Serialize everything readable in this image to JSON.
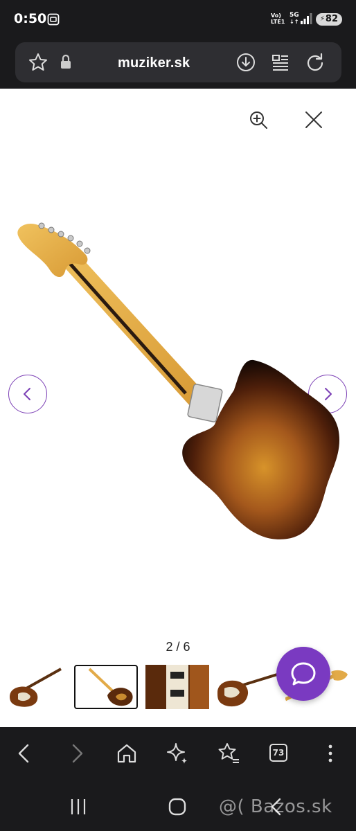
{
  "status_bar": {
    "time": "0:50",
    "network_top": "Vo)",
    "network_bottom": "LTE1",
    "network_type": "5G",
    "battery": "82"
  },
  "browser": {
    "url": "muziker.sk",
    "tab_count": "73",
    "icons": [
      "star-icon",
      "lock-icon",
      "download-icon",
      "reader-icon",
      "reload-icon"
    ],
    "nav_icons": [
      "back-icon",
      "forward-icon",
      "home-icon",
      "sparkle-icon",
      "bookmarks-icon",
      "tabs-icon",
      "more-icon"
    ]
  },
  "gallery": {
    "counter": "2 / 6",
    "thumbnails": [
      "Jaguar front",
      "Jaguar back",
      "Jaguar body detail",
      "Jaguar front angle",
      "Jaguar headstock"
    ],
    "selected_index": 1,
    "accent_color": "#7a3ac1"
  },
  "watermark": "@( Bazos.sk"
}
